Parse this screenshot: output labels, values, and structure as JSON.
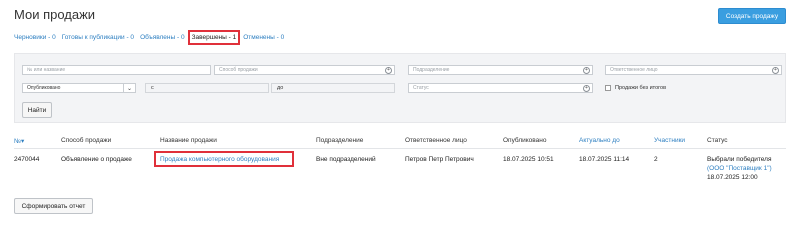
{
  "header": {
    "title": "Мои продажи",
    "create_button": "Создать продажу"
  },
  "tabs": [
    {
      "label": "Черновики - 0",
      "active": false
    },
    {
      "label": "Готовы к публикации - 0",
      "active": false
    },
    {
      "label": "Объявлены - 0",
      "active": false
    },
    {
      "label": "Завершены - 1",
      "active": true
    },
    {
      "label": "Отменены - 0",
      "active": false
    }
  ],
  "filters": {
    "number_placeholder": "№ или название",
    "method_placeholder": "Способ продажи",
    "department_placeholder": "Подразделение",
    "responsible_placeholder": "Ответственное лицо",
    "published_select": "Опубликовано",
    "date_from_label": "с",
    "date_to_label": "до",
    "status_placeholder": "Статус",
    "no_results_label": "Продажи без итогов",
    "find_button": "Найти"
  },
  "table": {
    "headers": {
      "number": "№",
      "method": "Способ продажи",
      "name": "Название продажи",
      "department": "Подразделение",
      "responsible": "Ответственное лицо",
      "published": "Опубликовано",
      "actual": "Актуально до",
      "participants": "Участники",
      "status": "Статус"
    },
    "sort_indicator": "▾",
    "rows": [
      {
        "number": "2470044",
        "method": "Объявление о продаже",
        "name": "Продажа компьютерного оборудования",
        "department": "Вне подразделений",
        "responsible": "Петров Петр Петрович",
        "published": "18.07.2025 10:51",
        "actual": "18.07.2025 11:14",
        "participants": "2",
        "status_line1": "Выбрали победителя",
        "status_winner": "(ООО \"Поставщик 1\")",
        "status_date": "18.07.2025 12:00"
      }
    ]
  },
  "footer": {
    "report_button": "Сформировать отчет"
  },
  "colors": {
    "accent": "#3a9ee0",
    "link": "#2d7fc1",
    "highlight": "#e0303a"
  },
  "icons": {
    "add": "plus-circle-icon",
    "dropdown": "chevron-down-icon"
  }
}
